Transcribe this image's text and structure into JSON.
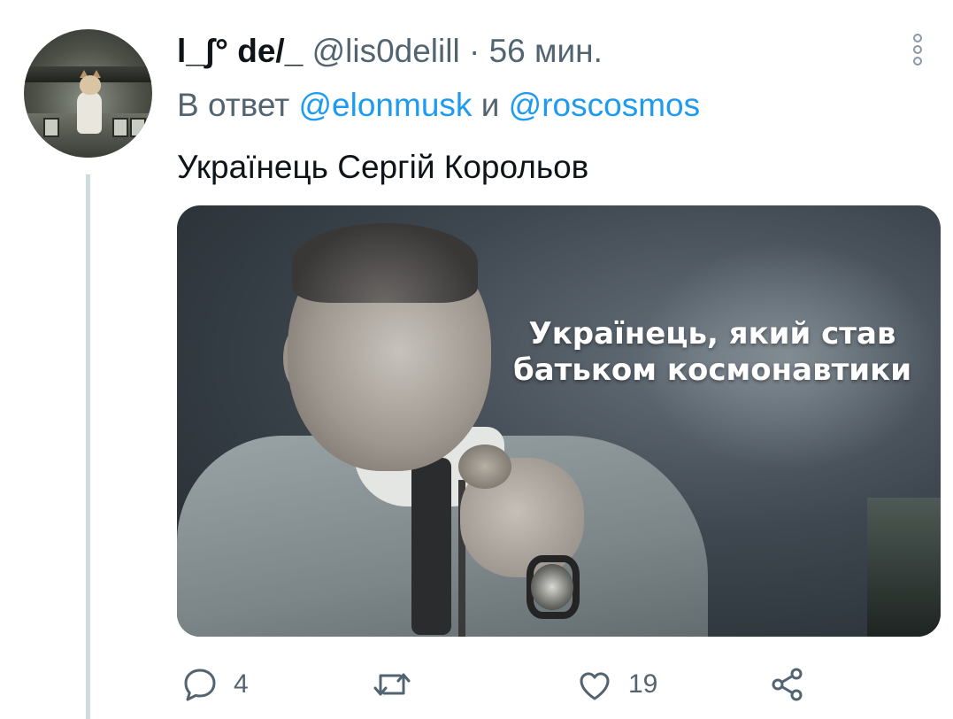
{
  "tweet": {
    "display_name": "l_ʃ° de/_",
    "handle": "@lis0delill",
    "separator": "·",
    "time": "56 мин.",
    "reply_to": {
      "prefix": "В ответ",
      "mention_1": "@elonmusk",
      "conjunction": "и",
      "mention_2": "@roscosmos"
    },
    "text": "Українець Сергій Корольов",
    "media": {
      "caption_line_1": "Українець, який став",
      "caption_line_2": "батьком космонавтики"
    },
    "actions": {
      "reply_count": "4",
      "retweet_count": "",
      "like_count": "19"
    },
    "icons": {
      "more": "more-vertical-icon",
      "reply": "reply-icon",
      "retweet": "retweet-icon",
      "like": "heart-icon",
      "share": "share-icon"
    },
    "colors": {
      "link": "#1d9bf0",
      "secondary_text": "#536471",
      "primary_text": "#0f1419",
      "thread_line": "#cfd9de"
    }
  }
}
